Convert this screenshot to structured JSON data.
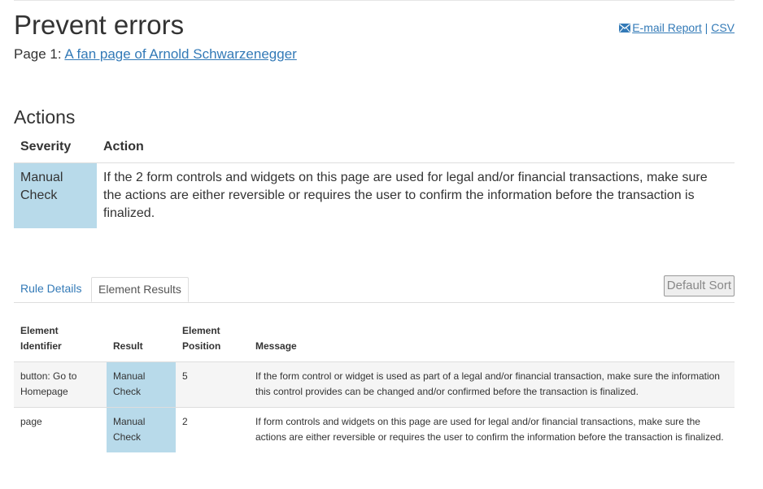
{
  "header": {
    "title": "Prevent errors",
    "page_prefix": "Page 1: ",
    "page_link": "A fan page of Arnold Schwarzenegger",
    "email_report": "E-mail Report",
    "separator": " | ",
    "csv": "CSV"
  },
  "actions": {
    "heading": "Actions",
    "col_severity": "Severity",
    "col_action": "Action",
    "rows": [
      {
        "severity": "Manual Check",
        "action": "If the 2 form controls and widgets on this page are used for legal and/or financial transactions, make sure the actions are either reversible or requires the user to confirm the information before the transaction is finalized."
      }
    ]
  },
  "tabs": {
    "rule_details": "Rule Details",
    "element_results": "Element Results",
    "default_sort": "Default Sort"
  },
  "results": {
    "col_identifier": "Element Identifier",
    "col_result": "Result",
    "col_position": "Element Position",
    "col_message": "Message",
    "rows": [
      {
        "identifier": "button: Go to Homepage",
        "result": "Manual Check",
        "position": "5",
        "message": "If the form control or widget is used as part of a legal and/or financial transaction, make sure the information this control provides can be changed and/or confirmed before the transaction is finalized."
      },
      {
        "identifier": "page",
        "result": "Manual Check",
        "position": "2",
        "message": "If form controls and widgets on this page are used for legal and/or financial transactions, make sure the actions are either reversible or requires the user to confirm the information before the transaction is finalized."
      }
    ]
  },
  "colors": {
    "link": "#337ab7",
    "severity_bg": "#b8daea",
    "row_alt_bg": "#f5f5f5"
  },
  "icons": {
    "email": "envelope-icon"
  }
}
